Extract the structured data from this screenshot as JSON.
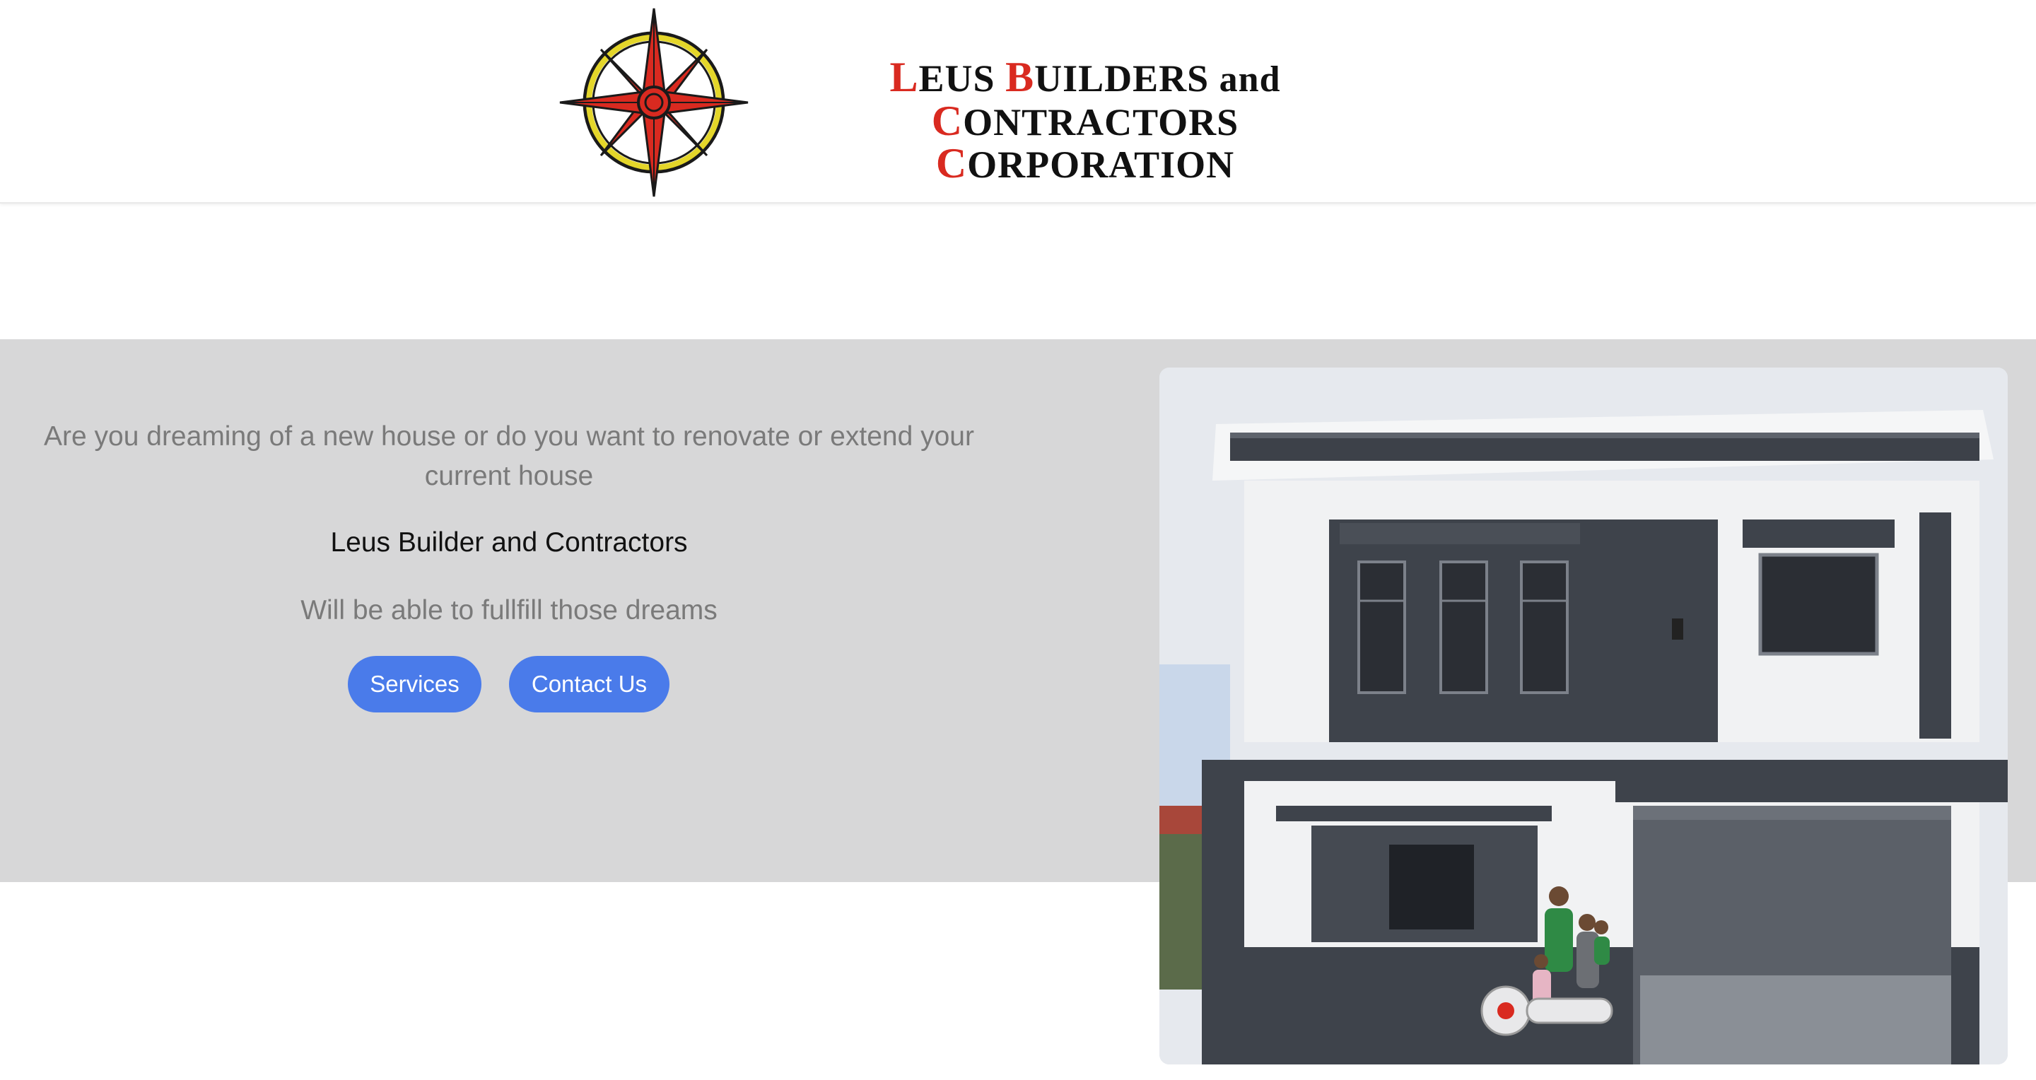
{
  "header": {
    "logo_icon": "compass-star-icon",
    "company_name": {
      "line1": [
        {
          "first": "L",
          "rest": "EUS "
        },
        {
          "first": "B",
          "rest": "UILDERS "
        },
        {
          "lower": "and "
        },
        {
          "first": "C",
          "rest": "ONTRACTORS"
        }
      ],
      "line2": [
        {
          "first": "C",
          "rest": "ORPORATION"
        }
      ]
    }
  },
  "hero": {
    "lead": "Are you dreaming of a new house or do you want to renovate or extend your current house",
    "brand": "Leus Builder and Contractors",
    "sub": "Will be able to fullfill those dreams",
    "buttons": {
      "services": "Services",
      "contact": "Contact Us"
    },
    "photo_icon": "house-photo"
  },
  "colors": {
    "accent_button": "#4a7bea",
    "hero_background": "#d7d7d8",
    "logo_red": "#d92a20",
    "logo_yellow": "#e4d62a"
  }
}
